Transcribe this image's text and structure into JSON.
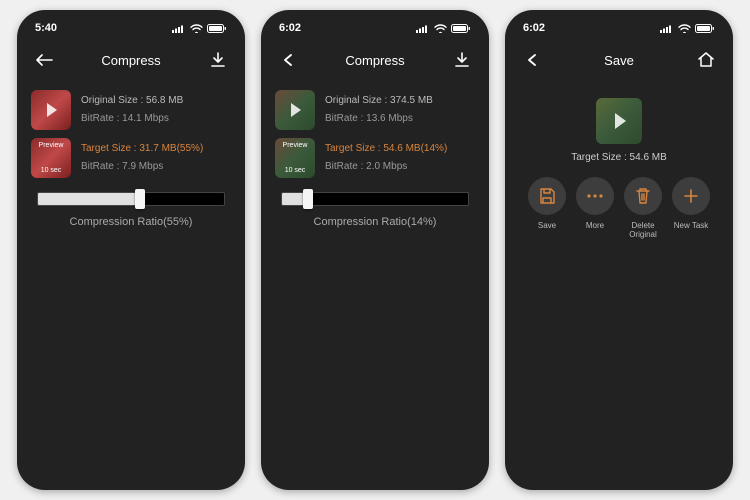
{
  "screens": [
    {
      "status": {
        "time": "5:40"
      },
      "nav": {
        "title": "Compress",
        "right_icon": "download"
      },
      "original": {
        "size_label": "Original Size : 56.8 MB",
        "bitrate_label": "BitRate : 14.1 Mbps"
      },
      "target": {
        "size_label": "Target Size : 31.7 MB(55%)",
        "bitrate_label": "BitRate : 7.9 Mbps",
        "preview": "Preview",
        "sec": "10 sec"
      },
      "slider": {
        "percent": 55
      },
      "ratio_label": "Compression Ratio(55%)"
    },
    {
      "status": {
        "time": "6:02"
      },
      "nav": {
        "title": "Compress",
        "right_icon": "download"
      },
      "original": {
        "size_label": "Original Size : 374.5 MB",
        "bitrate_label": "BitRate : 13.6 Mbps"
      },
      "target": {
        "size_label": "Target Size : 54.6 MB(14%)",
        "bitrate_label": "BitRate : 2.0 Mbps",
        "preview": "Preview",
        "sec": "10 sec"
      },
      "slider": {
        "percent": 14
      },
      "ratio_label": "Compression Ratio(14%)"
    },
    {
      "status": {
        "time": "6:02"
      },
      "nav": {
        "title": "Save",
        "right_icon": "home"
      },
      "save": {
        "target_label": "Target Size : 54.6 MB"
      },
      "actions": {
        "save": "Save",
        "more": "More",
        "delete": "Delete Original",
        "new": "New Task"
      }
    }
  ]
}
